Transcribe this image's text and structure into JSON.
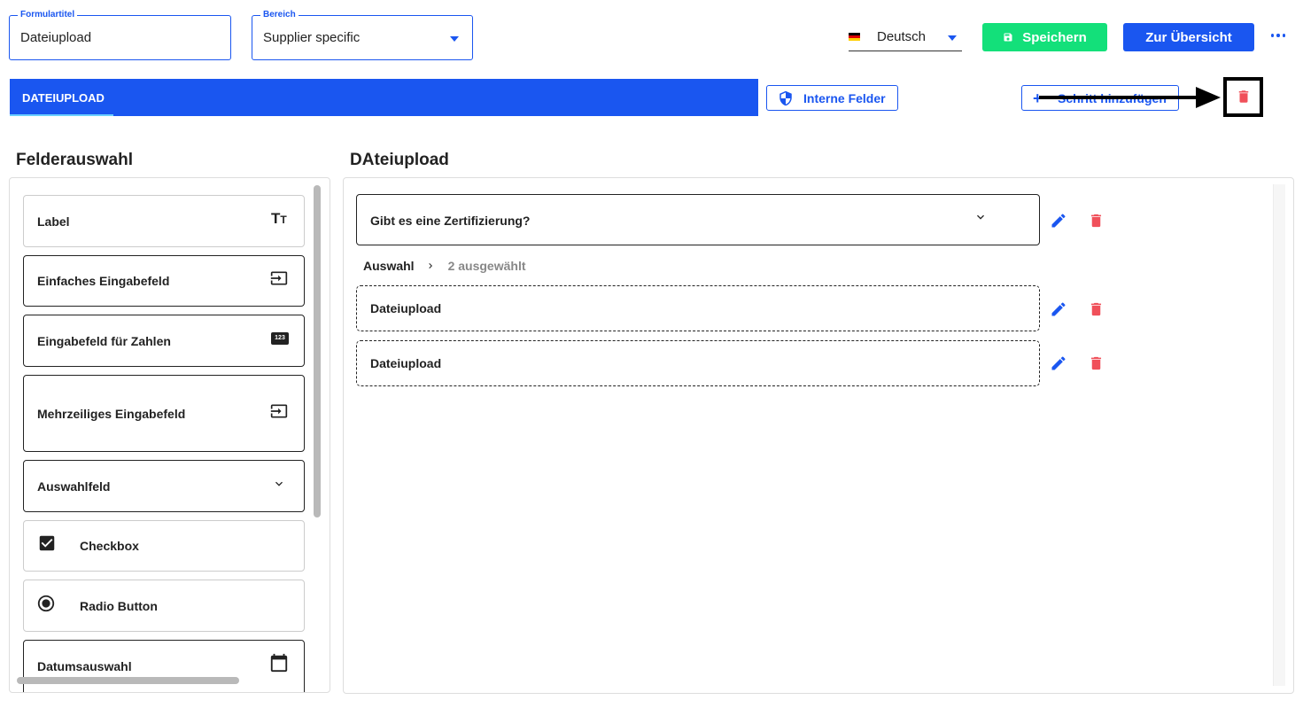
{
  "header": {
    "form_title": {
      "legend": "Formulartitel",
      "value": "Dateiupload"
    },
    "area": {
      "legend": "Bereich",
      "value": "Supplier specific"
    },
    "language": "Deutsch",
    "save_label": "Speichern",
    "overview_label": "Zur Übersicht"
  },
  "tabs": [
    {
      "label": "DATEIUPLOAD",
      "active": true
    }
  ],
  "toolbar": {
    "internal_fields_label": "Interne Felder",
    "add_step_label": "Schritt hinzufügen"
  },
  "field_selection": {
    "heading": "Felderauswahl",
    "items": [
      {
        "label": "Label",
        "icon": "text-size-icon"
      },
      {
        "label": "Einfaches Eingabefeld",
        "icon": "input-icon"
      },
      {
        "label": "Eingabefeld für Zahlen",
        "icon": "number-123-icon"
      },
      {
        "label": "Mehrzeiliges Eingabefeld",
        "icon": "input-icon"
      },
      {
        "label": "Auswahlfeld",
        "icon": "chevron-down-icon"
      },
      {
        "label": "Checkbox",
        "icon": "checkbox-checked-icon"
      },
      {
        "label": "Radio Button",
        "icon": "radio-checked-icon"
      },
      {
        "label": "Datumsauswahl",
        "icon": "calendar-icon"
      }
    ]
  },
  "step": {
    "heading": "DAteiupload",
    "question": "Gibt es eine Zertifizierung?",
    "breadcrumb": {
      "parent": "Auswahl",
      "current": "2 ausgewählt"
    },
    "fields": [
      {
        "label": "Dateiupload"
      },
      {
        "label": "Dateiupload"
      }
    ]
  },
  "colors": {
    "primary": "#1a56f0",
    "success": "#13e07a",
    "danger": "#f0505a",
    "annotation": "#000000"
  }
}
